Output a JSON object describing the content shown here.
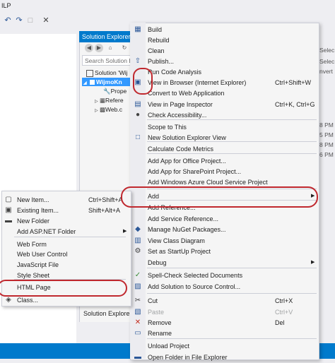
{
  "window": {
    "help_label": "ILP"
  },
  "solution_explorer": {
    "title": "Solution Explorer",
    "search_placeholder": "Search Solution Ex",
    "tree": [
      {
        "label": "Solution 'Wij",
        "icon": "solution-icon"
      },
      {
        "label": "WijmoKn",
        "icon": "web-project-icon"
      },
      {
        "label": "Prope",
        "icon": "wrench-icon"
      },
      {
        "label": "Refere",
        "icon": "references-icon"
      },
      {
        "label": "Web.c",
        "icon": "config-file-icon"
      }
    ],
    "footer_tab": "Solution Explorer"
  },
  "right_peek": [
    "Selec",
    "Selec",
    "nvert",
    "8 PM",
    "5 PM",
    "8 PM",
    "6 PM"
  ],
  "context_menu": {
    "items": [
      {
        "label": "Build",
        "shortcut": "",
        "icon": "build-icon"
      },
      {
        "label": "Rebuild",
        "shortcut": "",
        "icon": ""
      },
      {
        "label": "Clean",
        "shortcut": "",
        "icon": ""
      },
      {
        "label": "Publish...",
        "shortcut": "",
        "icon": "publish-icon"
      },
      {
        "label": "Run Code Analysis",
        "shortcut": "",
        "icon": ""
      },
      {
        "label": "View in Browser (Internet Explorer)",
        "shortcut": "Ctrl+Shift+W",
        "icon": "browser-icon"
      },
      {
        "label": "Convert to Web Application",
        "shortcut": "",
        "icon": ""
      },
      {
        "label": "View in Page Inspector",
        "shortcut": "Ctrl+K, Ctrl+G",
        "icon": "page-inspector-icon"
      },
      {
        "label": "Check Accessibility...",
        "shortcut": "",
        "icon": "accessibility-icon"
      },
      {
        "label": "Scope to This",
        "shortcut": "",
        "icon": ""
      },
      {
        "label": "New Solution Explorer View",
        "shortcut": "",
        "icon": "new-view-icon"
      },
      {
        "label": "Calculate Code Metrics",
        "shortcut": "",
        "icon": ""
      },
      {
        "label": "Add App for Office Project...",
        "shortcut": "",
        "icon": ""
      },
      {
        "label": "Add App for SharePoint Project...",
        "shortcut": "",
        "icon": ""
      },
      {
        "label": "Add Windows Azure Cloud Service Project",
        "shortcut": "",
        "icon": ""
      },
      {
        "label": "Add",
        "shortcut": "",
        "icon": ""
      },
      {
        "label": "Add Reference...",
        "shortcut": "",
        "icon": ""
      },
      {
        "label": "Add Service Reference...",
        "shortcut": "",
        "icon": ""
      },
      {
        "label": "Manage NuGet Packages...",
        "shortcut": "",
        "icon": "nuget-icon"
      },
      {
        "label": "View Class Diagram",
        "shortcut": "",
        "icon": "class-diagram-icon"
      },
      {
        "label": "Set as StartUp Project",
        "shortcut": "",
        "icon": "gear-icon"
      },
      {
        "label": "Debug",
        "shortcut": "",
        "icon": ""
      },
      {
        "label": "Spell-Check Selected Documents",
        "shortcut": "",
        "icon": "spellcheck-icon"
      },
      {
        "label": "Add Solution to Source Control...",
        "shortcut": "",
        "icon": "source-control-icon"
      },
      {
        "label": "Cut",
        "shortcut": "Ctrl+X",
        "icon": "cut-icon"
      },
      {
        "label": "Paste",
        "shortcut": "Ctrl+V",
        "icon": "paste-icon"
      },
      {
        "label": "Remove",
        "shortcut": "Del",
        "icon": "remove-icon"
      },
      {
        "label": "Rename",
        "shortcut": "",
        "icon": "rename-icon"
      },
      {
        "label": "Unload Project",
        "shortcut": "",
        "icon": ""
      },
      {
        "label": "Open Folder in File Explorer",
        "shortcut": "",
        "icon": "folder-icon"
      }
    ]
  },
  "add_submenu": {
    "items": [
      {
        "label": "New Item...",
        "shortcut": "Ctrl+Shift+A",
        "icon": "new-item-icon"
      },
      {
        "label": "Existing Item...",
        "shortcut": "Shift+Alt+A",
        "icon": "existing-item-icon"
      },
      {
        "label": "New Folder",
        "shortcut": "",
        "icon": "new-folder-icon"
      },
      {
        "label": "Add ASP.NET Folder",
        "shortcut": "",
        "icon": ""
      },
      {
        "label": "Web Form",
        "shortcut": "",
        "icon": ""
      },
      {
        "label": "Web User Control",
        "shortcut": "",
        "icon": ""
      },
      {
        "label": "JavaScript File",
        "shortcut": "",
        "icon": ""
      },
      {
        "label": "Style Sheet",
        "shortcut": "",
        "icon": ""
      },
      {
        "label": "HTML Page",
        "shortcut": "",
        "icon": ""
      },
      {
        "label": "Class...",
        "shortcut": "",
        "icon": "class-icon"
      }
    ]
  },
  "colors": {
    "accent": "#007acc",
    "highlight_ring": "#c0282e",
    "menu_bg": "#f5f5f5",
    "selection": "#3399ff"
  }
}
